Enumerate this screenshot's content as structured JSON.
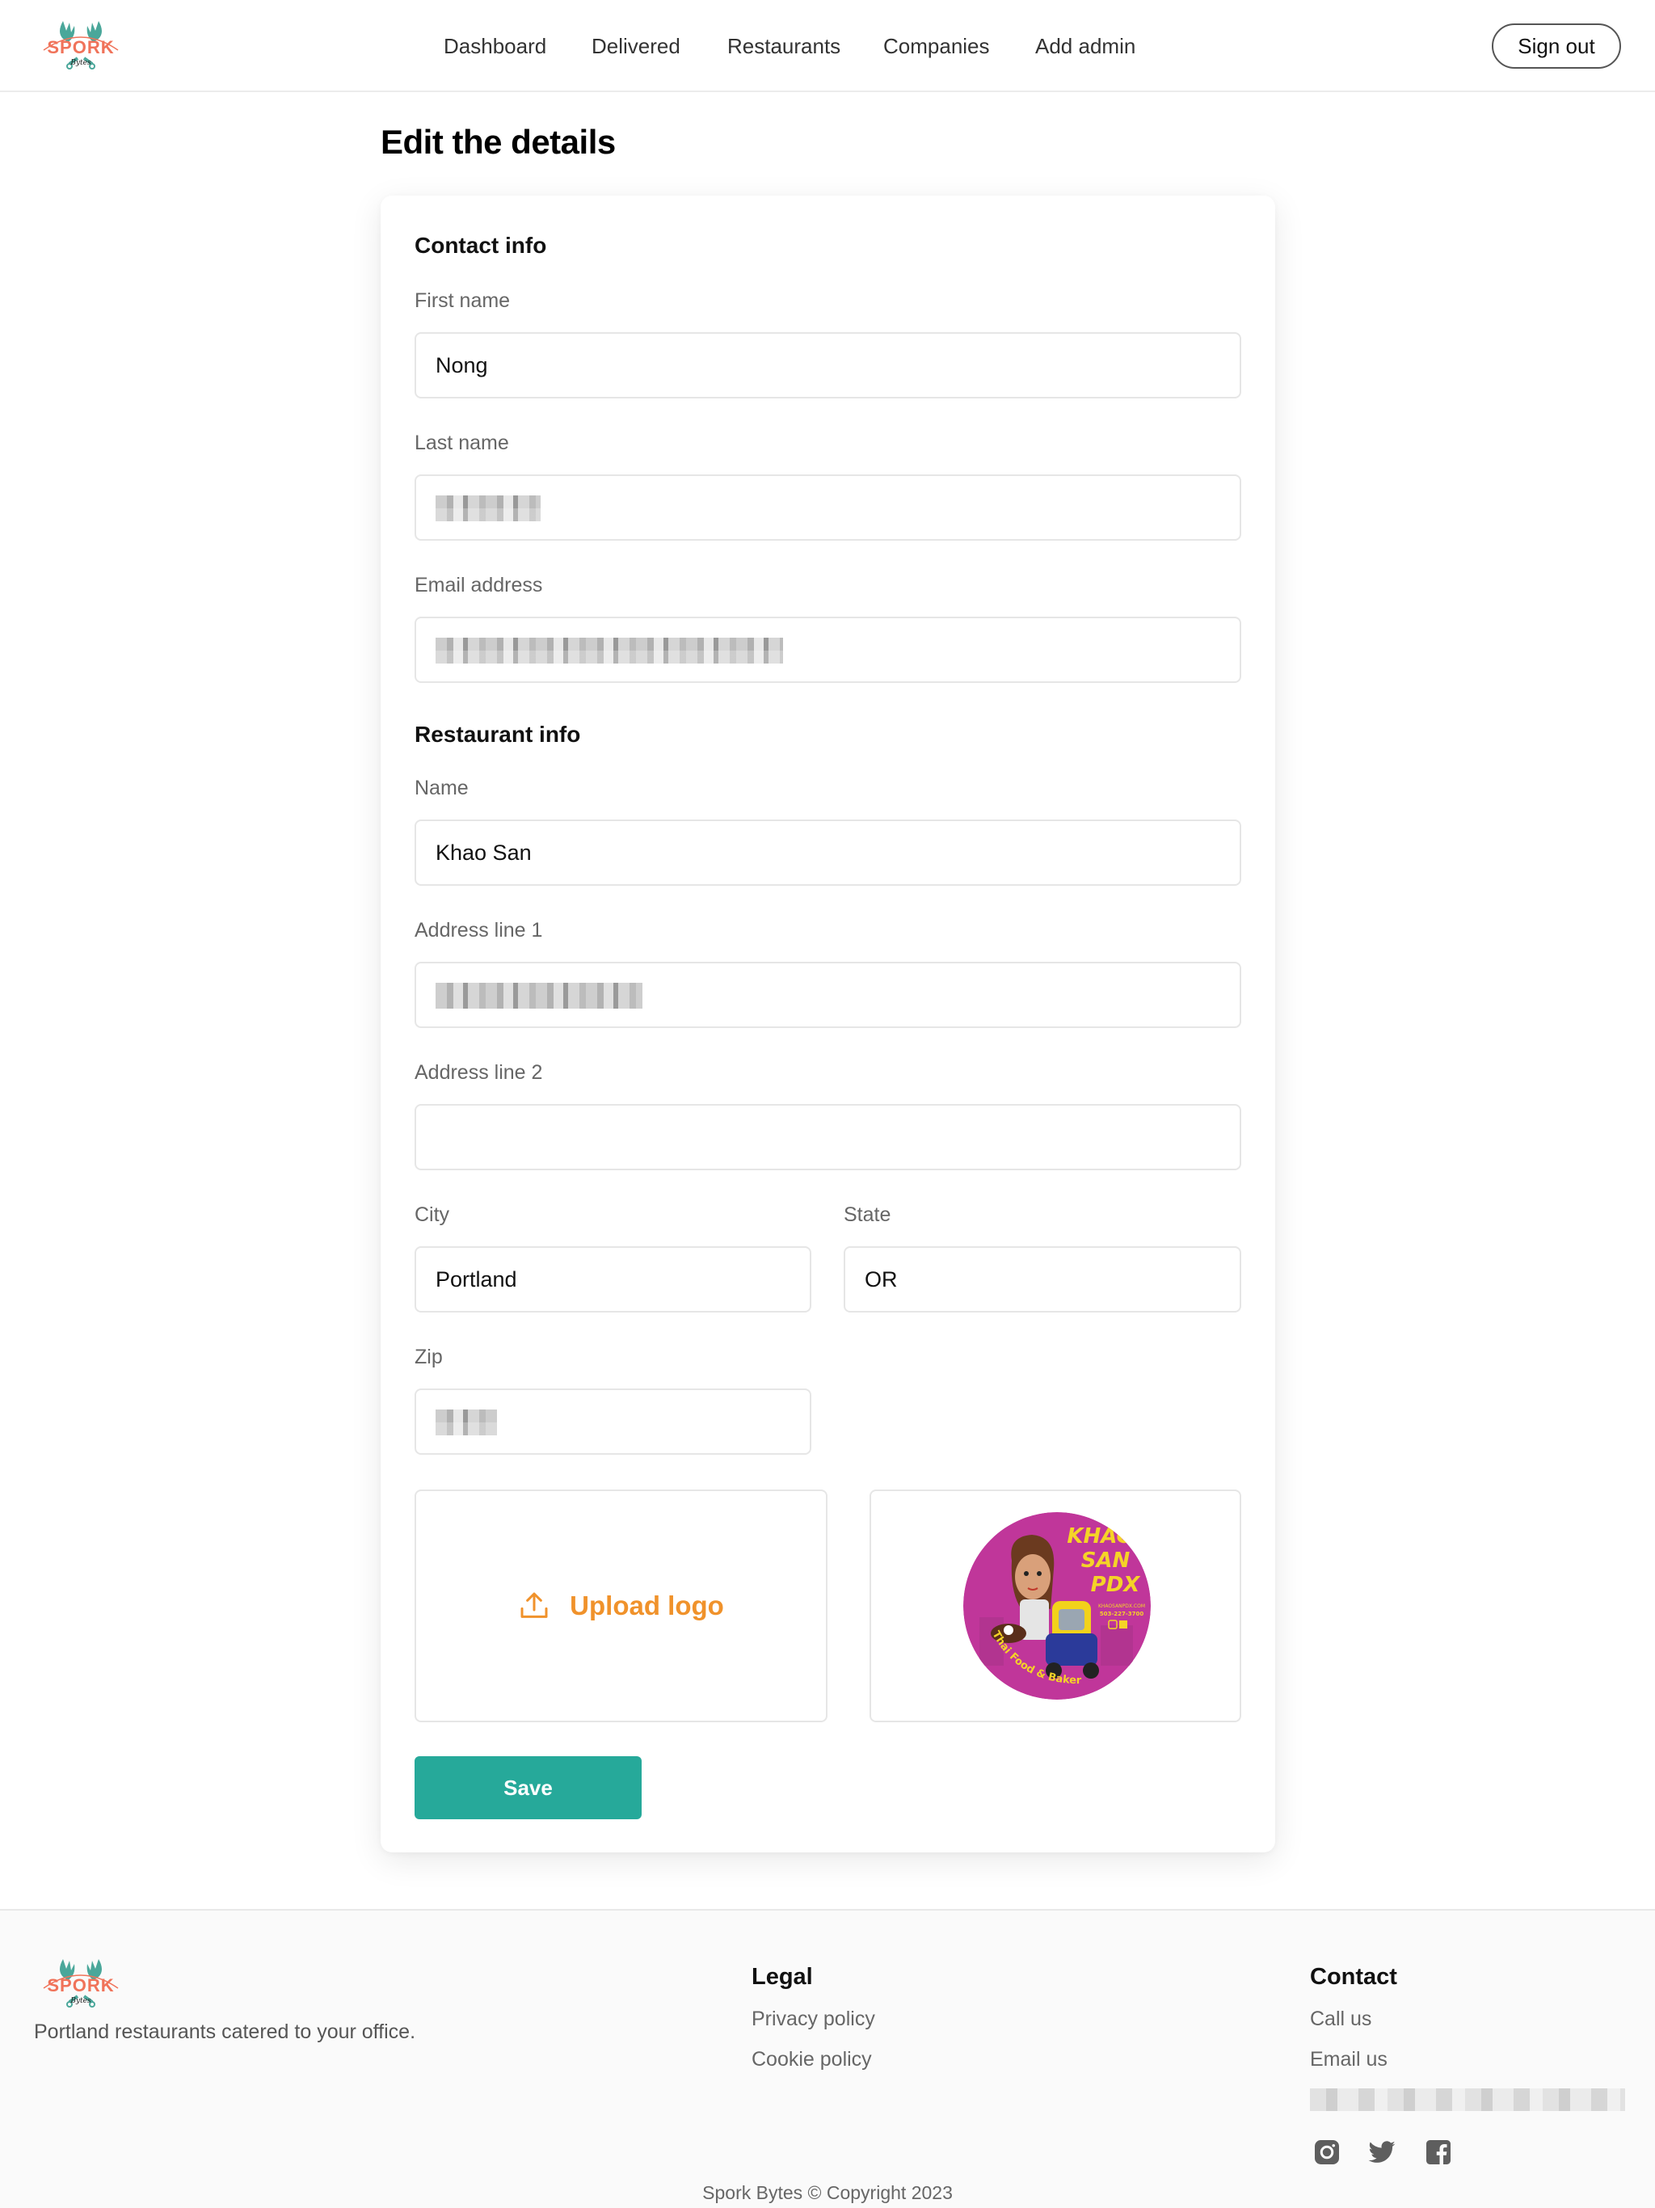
{
  "header": {
    "brand": "Spork Bytes",
    "logo_icon": "spork-bytes-logo",
    "nav": [
      {
        "label": "Dashboard"
      },
      {
        "label": "Delivered"
      },
      {
        "label": "Restaurants"
      },
      {
        "label": "Companies"
      },
      {
        "label": "Add admin"
      }
    ],
    "sign_out_label": "Sign out"
  },
  "page": {
    "title": "Edit the details"
  },
  "form": {
    "contact_heading": "Contact info",
    "first_name": {
      "label": "First name",
      "value": "Nong"
    },
    "last_name": {
      "label": "Last name",
      "value": "[redacted]"
    },
    "email": {
      "label": "Email address",
      "value": "[redacted]"
    },
    "restaurant_heading": "Restaurant info",
    "name": {
      "label": "Name",
      "value": "Khao San"
    },
    "address1": {
      "label": "Address line 1",
      "value": "[redacted]"
    },
    "address2": {
      "label": "Address line 2",
      "value": ""
    },
    "city": {
      "label": "City",
      "value": "Portland"
    },
    "state": {
      "label": "State",
      "value": "OR"
    },
    "zip": {
      "label": "Zip",
      "value": "[redacted]"
    },
    "upload_label": "Upload logo",
    "upload_icon": "upload-icon",
    "logo_preview": {
      "title_lines": [
        "KHAO",
        "SAN",
        "PDX"
      ],
      "website": "KHAOSANPDX.COM",
      "phone": "503-227-3700",
      "tagline": "Thai Food & Bakery"
    },
    "save_label": "Save"
  },
  "footer": {
    "tagline": "Portland restaurants catered to your office.",
    "legal_heading": "Legal",
    "legal_links": [
      {
        "label": "Privacy policy"
      },
      {
        "label": "Cookie policy"
      }
    ],
    "contact_heading": "Contact",
    "contact_links": [
      {
        "label": "Call us"
      },
      {
        "label": "Email us"
      }
    ],
    "contact_email": "[redacted]",
    "social": [
      "instagram-icon",
      "twitter-icon",
      "facebook-icon"
    ],
    "copyright": "Spork Bytes © Copyright 2023"
  },
  "colors": {
    "accent": "#26a99a",
    "upload": "#f0922b",
    "logo_teal": "#4aa79a",
    "logo_coral": "#f0735a",
    "preview_magenta": "#c0369a"
  }
}
